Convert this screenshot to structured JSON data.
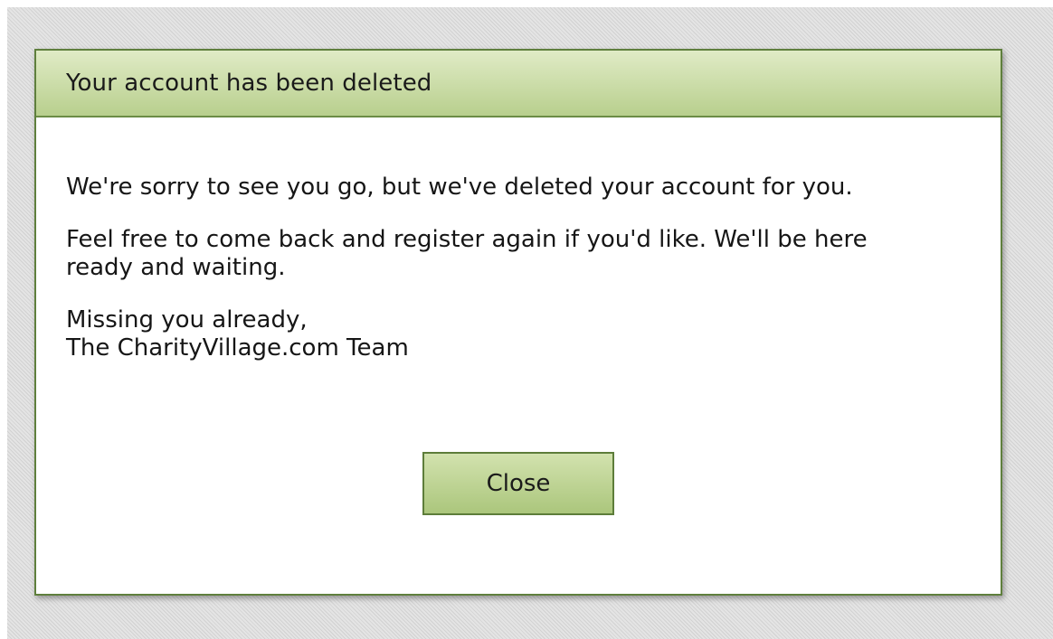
{
  "dialog": {
    "title": "Your account has been deleted",
    "paragraph_1": "We're sorry to see you go, but we've deleted your account for you.",
    "paragraph_2_line_1": "Feel free to come back and register again if you'd like. We'll be here",
    "paragraph_2_line_2": "ready and waiting.",
    "signoff_line_1": "Missing you already,",
    "signoff_line_2": "The CharityVillage.com Team",
    "close_label": "Close"
  },
  "colors": {
    "header_gradient_top": "#e0ebc6",
    "header_gradient_bottom": "#b8cf8d",
    "border_green": "#5f7f3d",
    "button_gradient_top": "#d2e2ae",
    "button_gradient_bottom": "#abc67c"
  }
}
